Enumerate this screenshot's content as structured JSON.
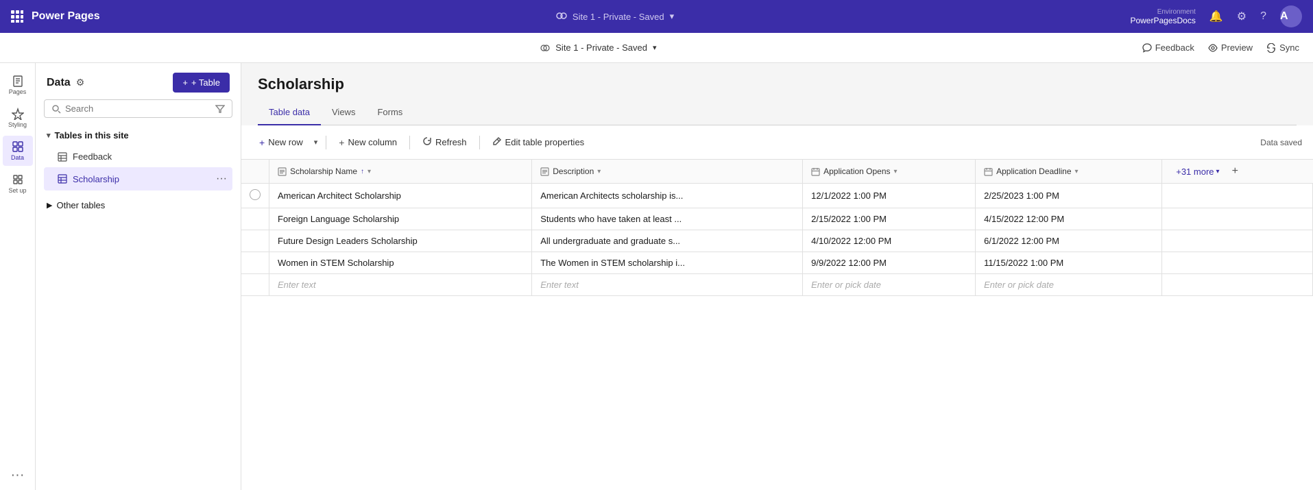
{
  "topNav": {
    "app_name": "Power Pages",
    "site_name": "Site 1 - Private - Saved",
    "environment_label": "Environment",
    "environment_name": "PowerPagesDocs",
    "feedback_label": "Feedback",
    "preview_label": "Preview",
    "sync_label": "Sync"
  },
  "sidebar": {
    "items": [
      {
        "id": "pages",
        "label": "Pages",
        "icon": "📄"
      },
      {
        "id": "styling",
        "label": "Styling",
        "icon": "🎨"
      },
      {
        "id": "data",
        "label": "Data",
        "icon": "⊞"
      },
      {
        "id": "setup",
        "label": "Set up",
        "icon": "🔧"
      }
    ]
  },
  "leftPanel": {
    "title": "Data",
    "add_button": "+ Table",
    "search_placeholder": "Search",
    "tables_section_title": "Tables in this site",
    "tables": [
      {
        "id": "feedback",
        "name": "Feedback",
        "active": false
      },
      {
        "id": "scholarship",
        "name": "Scholarship",
        "active": true
      }
    ],
    "other_tables_title": "Other tables"
  },
  "mainContent": {
    "page_title": "Scholarship",
    "tabs": [
      {
        "id": "table-data",
        "label": "Table data",
        "active": true
      },
      {
        "id": "views",
        "label": "Views",
        "active": false
      },
      {
        "id": "forms",
        "label": "Forms",
        "active": false
      }
    ],
    "toolbar": {
      "new_row_label": "New row",
      "new_column_label": "New column",
      "refresh_label": "Refresh",
      "edit_table_label": "Edit table properties",
      "data_saved_label": "Data saved",
      "more_cols_label": "+31 more"
    },
    "columns": [
      {
        "id": "scholarship-name",
        "label": "Scholarship Name",
        "type": "text",
        "sorted": true
      },
      {
        "id": "description",
        "label": "Description",
        "type": "text"
      },
      {
        "id": "application-opens",
        "label": "Application Opens",
        "type": "date"
      },
      {
        "id": "application-deadline",
        "label": "Application Deadline",
        "type": "date"
      }
    ],
    "rows": [
      {
        "scholarship_name": "American Architect Scholarship",
        "description": "American Architects scholarship is...",
        "application_opens": "12/1/2022 1:00 PM",
        "application_deadline": "2/25/2023 1:00 PM"
      },
      {
        "scholarship_name": "Foreign Language Scholarship",
        "description": "Students who have taken at least ...",
        "application_opens": "2/15/2022 1:00 PM",
        "application_deadline": "4/15/2022 12:00 PM"
      },
      {
        "scholarship_name": "Future Design Leaders Scholarship",
        "description": "All undergraduate and graduate s...",
        "application_opens": "4/10/2022 12:00 PM",
        "application_deadline": "6/1/2022 12:00 PM"
      },
      {
        "scholarship_name": "Women in STEM Scholarship",
        "description": "The Women in STEM scholarship i...",
        "application_opens": "9/9/2022 12:00 PM",
        "application_deadline": "11/15/2022 1:00 PM"
      }
    ],
    "empty_row": {
      "text_placeholder": "Enter text",
      "date_placeholder": "Enter or pick date"
    }
  }
}
